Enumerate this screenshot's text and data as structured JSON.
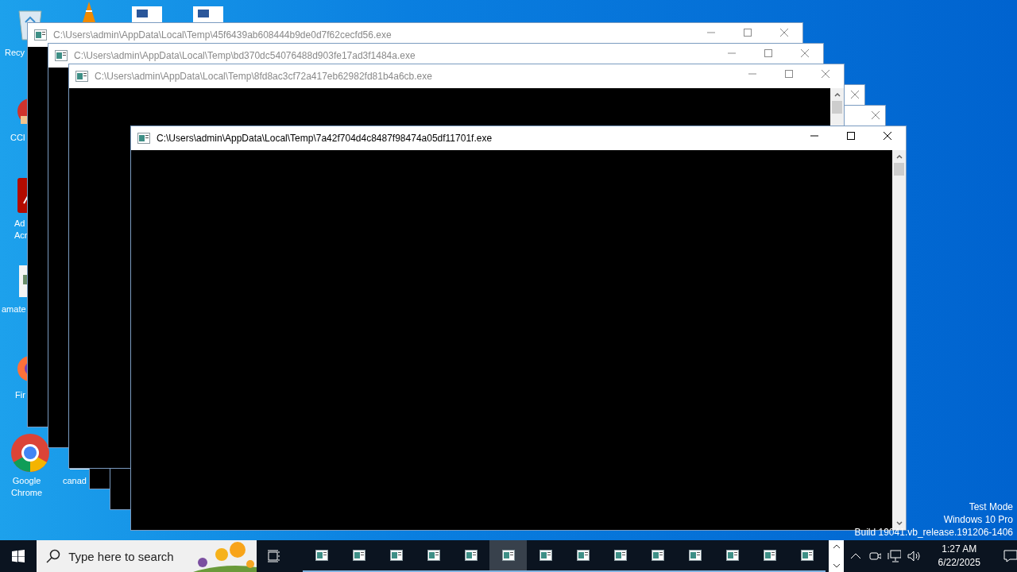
{
  "desktop_icons": [
    {
      "kind": "recycle",
      "lines": [
        "Recy"
      ]
    },
    {
      "kind": "ccleaner",
      "lines": [
        "CCl"
      ]
    },
    {
      "kind": "acrobat",
      "lines": [
        "Ad",
        "Acr"
      ]
    },
    {
      "kind": "image",
      "lines": [
        "amate"
      ]
    },
    {
      "kind": "firefox",
      "lines": [
        "Fir"
      ]
    },
    {
      "kind": "chrome",
      "lines": [
        "Google",
        "Chrome"
      ]
    },
    {
      "kind": "file",
      "lines": [
        "canad"
      ]
    }
  ],
  "windows": [
    {
      "kind": "console",
      "title": "C:\\Users\\admin\\AppData\\Local\\Temp\\45f6439ab608444b9de0d7f62cecfd56.exe",
      "active": false
    },
    {
      "kind": "console",
      "title": "C:\\Users\\admin\\AppData\\Local\\Temp\\bd370dc54076488d903fe17ad3f1484a.exe",
      "active": false
    },
    {
      "kind": "console",
      "title": "C:\\Users\\admin\\AppData\\Local\\Temp\\8fd8ac3cf72a417eb62982fd81b4a6cb.exe",
      "active": false,
      "scrollbar": true
    },
    {
      "kind": "console",
      "active": false
    },
    {
      "kind": "console",
      "active": false
    },
    {
      "kind": "console",
      "title": "C:\\Users\\admin\\AppData\\Local\\Temp\\7a42f704d4c8487f98474a05df11701f.exe",
      "active": true,
      "scrollbar": true
    }
  ],
  "watermark": [
    "Test Mode",
    "Windows 10 Pro",
    "Build 19041.vb_release.191206-1406"
  ],
  "taskbar": {
    "search": {
      "placeholder": "Type here to search"
    },
    "apps": [
      {
        "selected": false
      },
      {
        "selected": false
      },
      {
        "selected": false
      },
      {
        "selected": false
      },
      {
        "selected": false
      },
      {
        "selected": true
      },
      {
        "selected": false
      },
      {
        "selected": false
      },
      {
        "selected": false
      },
      {
        "selected": false
      },
      {
        "selected": false
      },
      {
        "selected": false
      },
      {
        "selected": false
      },
      {
        "selected": false
      }
    ],
    "time": "1:27 AM",
    "date": "6/22/2025"
  }
}
